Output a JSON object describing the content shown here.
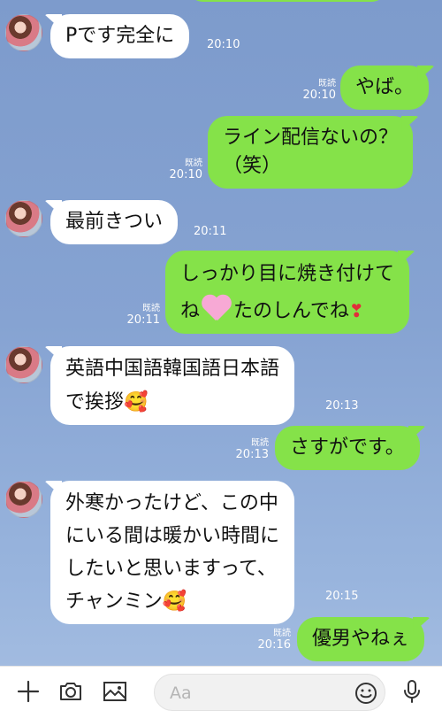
{
  "messages": [
    {
      "dir": "in",
      "text": "Pです完全に",
      "time": "20:10"
    },
    {
      "dir": "out",
      "text": "やば。",
      "time": "20:10",
      "read": "既読"
    },
    {
      "dir": "out",
      "lines": [
        "ライン配信ないの？",
        "（笑）"
      ],
      "time": "20:10",
      "read": "既読"
    },
    {
      "dir": "in",
      "text": "最前きつい",
      "time": "20:11"
    },
    {
      "dir": "out",
      "line1": "しっかり目に焼き付けて",
      "line2_a": "ね",
      "line2_b": "たのしんでね",
      "time": "20:11",
      "read": "既読"
    },
    {
      "dir": "in",
      "line1": "英語中国語韓国語日本語",
      "line2": "で挨拶",
      "time": "20:13"
    },
    {
      "dir": "out",
      "text": "さすがです。",
      "time": "20:13",
      "read": "既読"
    },
    {
      "dir": "in",
      "lines": [
        "外寒かったけど、この中",
        "にいる間は暖かい時間に",
        "したいと思いますって、"
      ],
      "last": "チャンミン",
      "time": "20:15"
    },
    {
      "dir": "out",
      "text": "優男やねぇ",
      "time": "20:16",
      "read": "既読"
    }
  ],
  "input": {
    "placeholder": "Aa"
  },
  "icons": {
    "plus": "plus-icon",
    "camera": "camera-icon",
    "image": "image-icon",
    "emoji": "emoji-icon",
    "mic": "microphone-icon"
  },
  "colors": {
    "out_bubble": "#85e249",
    "in_bubble": "#ffffff",
    "background": "#86a3d2"
  }
}
